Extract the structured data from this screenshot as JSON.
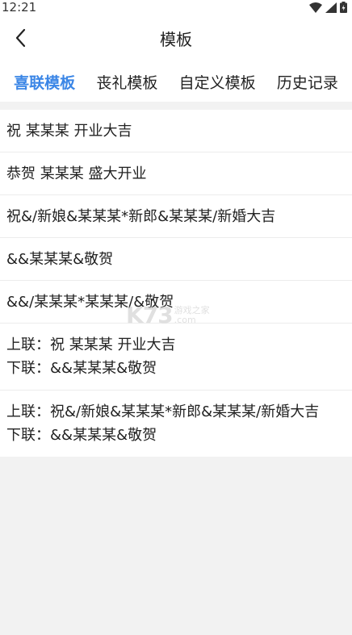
{
  "status_bar": {
    "time": "12:21"
  },
  "nav": {
    "title": "模板"
  },
  "tabs": [
    {
      "label": "喜联模板",
      "active": true
    },
    {
      "label": "丧礼模板",
      "active": false
    },
    {
      "label": "自定义模板",
      "active": false
    },
    {
      "label": "历史记录",
      "active": false
    }
  ],
  "templates": [
    {
      "lines": [
        "祝 某某某 开业大吉"
      ]
    },
    {
      "lines": [
        "恭贺 某某某 盛大开业"
      ]
    },
    {
      "lines": [
        "祝&/新娘&某某某*新郎&某某某/新婚大吉"
      ]
    },
    {
      "lines": [
        "&&某某某&敬贺"
      ]
    },
    {
      "lines": [
        "&&/某某某*某某某/&敬贺"
      ]
    },
    {
      "lines": [
        "上联：祝 某某某 开业大吉",
        "下联：&&某某某&敬贺"
      ]
    },
    {
      "lines": [
        "上联：祝&/新娘&某某某*新郎&某某某/新婚大吉",
        "下联：&&某某某&敬贺"
      ]
    }
  ],
  "watermark": {
    "logo": "K73",
    "text_line1": "游戏之家",
    "text_line2": ".com"
  },
  "colors": {
    "accent": "#3b86e6",
    "background": "#f2f2f2"
  }
}
